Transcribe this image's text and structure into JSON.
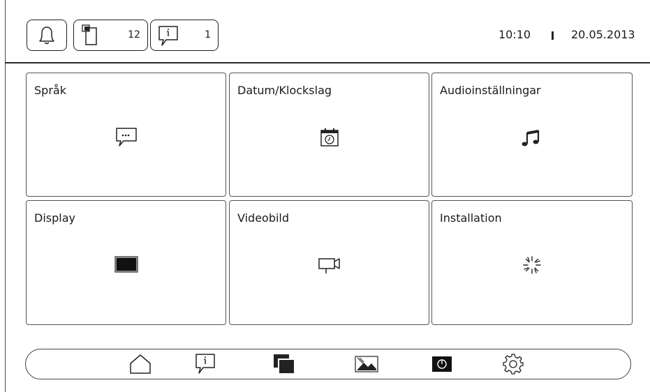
{
  "header": {
    "bell_icon": "bell-icon",
    "messages_icon": "phone-messages-icon",
    "messages_count": "12",
    "info_icon": "info-message-icon",
    "info_count": "1",
    "time": "10:10",
    "date": "20.05.2013"
  },
  "tiles": [
    {
      "label": "Språk",
      "icon": "speech-bubble-icon"
    },
    {
      "label": "Datum/Klockslag",
      "icon": "calendar-clock-icon"
    },
    {
      "label": "Audioinställningar",
      "icon": "music-note-icon"
    },
    {
      "label": "Display",
      "icon": "display-icon"
    },
    {
      "label": "Videobild",
      "icon": "video-camera-icon"
    },
    {
      "label": "Installation",
      "icon": "installation-spinner-icon"
    }
  ],
  "nav": {
    "items": [
      "home-icon",
      "info-message-icon",
      "gallery-icon",
      "picture-icon",
      "power-icon",
      "settings-gear-icon"
    ]
  },
  "colors": {
    "background": "#ffffff",
    "foreground": "#1a1a1a",
    "border": "#555555"
  }
}
